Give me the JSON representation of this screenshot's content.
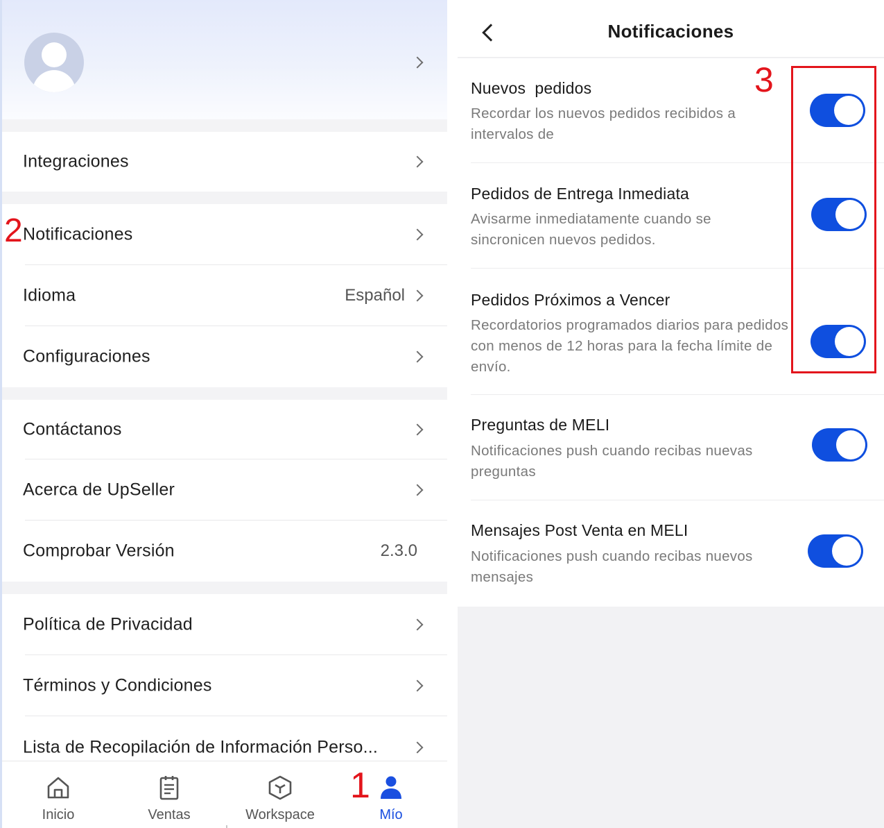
{
  "colors": {
    "accent": "#1a4fe0",
    "toggle_on": "#0f4fdf",
    "annotation": "#e3151c"
  },
  "profile": {
    "avatar_icon": "user-avatar-icon"
  },
  "menu": {
    "integraciones": "Integraciones",
    "notificaciones": "Notificaciones",
    "idioma": "Idioma",
    "idioma_value": "Español",
    "configuraciones": "Configuraciones",
    "contactanos": "Contáctanos",
    "acerca": "Acerca de UpSeller",
    "version": "Comprobar Versión",
    "version_value": "2.3.0",
    "privacidad": "Política de Privacidad",
    "terminos": "Términos y Condiciones",
    "lista": "Lista de Recopilación de Información Perso..."
  },
  "tabbar": {
    "tabs": [
      {
        "label": "Inicio",
        "icon": "home-icon"
      },
      {
        "label": "Ventas",
        "icon": "clipboard-icon"
      },
      {
        "label": "Workspace",
        "icon": "cube-icon"
      },
      {
        "label": "Mío",
        "icon": "person-icon",
        "active": true
      }
    ]
  },
  "notifications": {
    "title": "Notificaciones",
    "items": [
      {
        "title": "Nuevos  pedidos",
        "description": "Recordar los nuevos pedidos recibidos a intervalos de",
        "enabled": true
      },
      {
        "title": "Pedidos de Entrega Inmediata",
        "description": "Avisarme inmediatamente cuando se sincronicen nuevos pedidos.",
        "enabled": true
      },
      {
        "title": "Pedidos Próximos a Vencer",
        "description": "Recordatorios programados diarios para pedidos con menos de 12 horas para la fecha límite de envío.",
        "enabled": true
      },
      {
        "title": "Preguntas de MELI",
        "description": "Notificaciones push cuando recibas nuevas preguntas",
        "enabled": true
      },
      {
        "title": "Mensajes Post Venta en MELI",
        "description": "Notificaciones push cuando recibas nuevos mensajes",
        "enabled": true
      }
    ]
  },
  "annotations": {
    "step1": "1",
    "step2": "2",
    "step3": "3"
  }
}
